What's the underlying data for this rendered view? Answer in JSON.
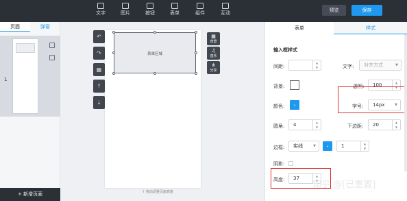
{
  "toolbar": {
    "items": [
      {
        "label": "文字",
        "icon": "text-icon"
      },
      {
        "label": "图片",
        "icon": "image-icon"
      },
      {
        "label": "按钮",
        "icon": "button-icon"
      },
      {
        "label": "表单",
        "icon": "form-icon"
      },
      {
        "label": "组件",
        "icon": "component-icon"
      },
      {
        "label": "互动",
        "icon": "interaction-icon"
      }
    ],
    "preview_label": "预览",
    "save_label": "保存"
  },
  "left_panel": {
    "tabs": [
      "页面",
      "弹窗"
    ],
    "page_number": "1",
    "add_page_label": "+ 新增页面"
  },
  "canvas": {
    "form_box_text": "表单区域",
    "hint": "↑ 拖动调整页面高度"
  },
  "right_tools": [
    {
      "glyph": "▦",
      "label": "背景"
    },
    {
      "glyph": "♫",
      "label": "音乐"
    },
    {
      "glyph": "⋔",
      "label": "分享"
    }
  ],
  "props": {
    "tabs": [
      "表单",
      "样式"
    ],
    "section_title": "输入框样式",
    "spacing_label": "间距:",
    "spacing_value": "",
    "text_label": "文字:",
    "text_align": "对齐方式",
    "bg_label": "背景:",
    "opacity_label": "透明:",
    "opacity_value": "100",
    "color_label": "颜色:",
    "fontsize_label": "字号:",
    "fontsize_value": "14px",
    "radius_label": "圆角:",
    "radius_value": "4",
    "bottom_margin_label": "下边距:",
    "bottom_margin_value": "20",
    "border_label": "边框:",
    "border_style": "实线",
    "border_width": "1",
    "shadow_label": "阴影:",
    "height_label": "高度:",
    "height_value": "37"
  },
  "watermark": "知乎 @[已重置]",
  "colors": {
    "accent": "#1f98f0",
    "highlight": "#e02d2d",
    "topbar": "#2b2f36"
  }
}
